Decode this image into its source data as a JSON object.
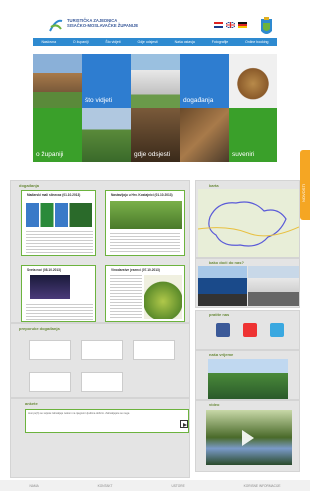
{
  "header": {
    "logo_line1": "TURISTIČKA ZAJEDNICA",
    "logo_line2": "SISAČKO-MOSLAVAČKE ŽUPANIJE"
  },
  "nav": [
    "Naslovna",
    "O županiji",
    "Što vidjeti",
    "Gdje odsjesti",
    "Naša ostavja",
    "Fotografije",
    "Online booking"
  ],
  "hero": {
    "tile_sto_vidjeti": "što vidjeti",
    "tile_dogadanja": "događanja",
    "tile_o_zupaniji": "o županiji",
    "tile_gdje_odsjesti": "gdje odsjesti",
    "tile_suveniri": "suveniri"
  },
  "side_tab": "NOVOSTI",
  "dogadanja": {
    "title": "događanja",
    "card1_title": "Mađarski mali slinecaz (01.10.2013)",
    "card2_title": "Nastavljaju u Hrv. Kostajnici (01.10.2013)",
    "card3_title": "Sveta noć (08.10.2013)",
    "card4_title": "Vinodarstve jesenci (07.10.2013)"
  },
  "karta": {
    "title": "karta"
  },
  "kako_doci": {
    "title": "kako doći do nas?"
  },
  "pratite_nas": {
    "title": "pratite nas"
  },
  "nasa_vrijeme": {
    "title": "naša vrijeme"
  },
  "video": {
    "title": "video"
  },
  "preporuke": {
    "title": "preporuke događanja"
  },
  "anketa": {
    "title": "ankete",
    "text": "Jesi pu(h) se svijeta zahvaljuje nekom na njegovim ljudima dobrim. Zahvaljujete se nega"
  },
  "footer": [
    "NAMA",
    "KONTAKT",
    "USTORE",
    "KORISNE INFORMACIJE"
  ]
}
